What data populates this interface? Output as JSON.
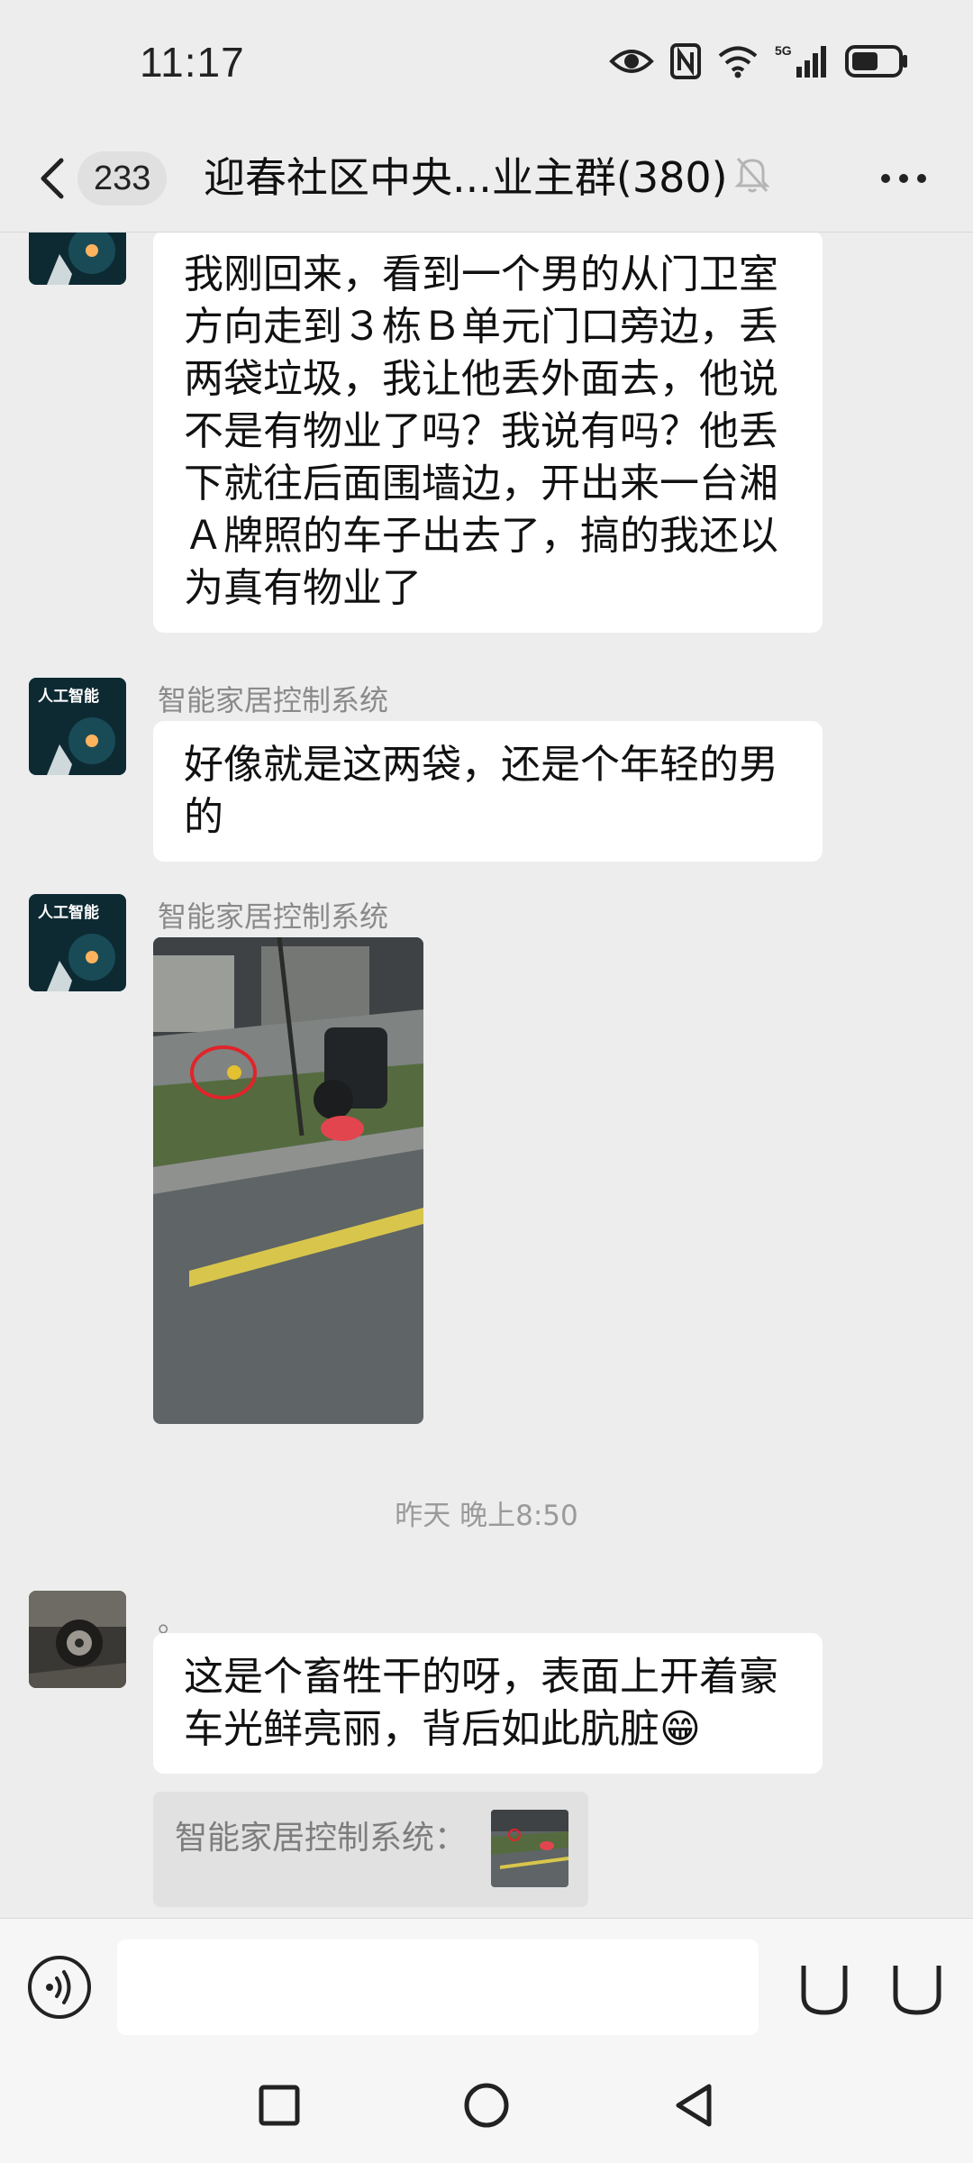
{
  "status_bar": {
    "time": "11:17",
    "network": "5G"
  },
  "header": {
    "unread_count": "233",
    "title": "迎春社区中央...业主群(380)"
  },
  "messages": [
    {
      "type": "text",
      "text": "我刚回来，看到一个男的从门卫室方向走到３栋Ｂ单元门口旁边，丢两袋垃圾，我让他丢外面去，他说不是有物业了吗？我说有吗？他丢下就往后面围墙边，开出来一台湘Ａ牌照的车子出去了，搞的我还以为真有物业了"
    },
    {
      "type": "text",
      "sender": "智能家居控制系统",
      "avatar_text": "人工智能",
      "text": "好像就是这两袋，还是个年轻的男的"
    },
    {
      "type": "image",
      "sender": "智能家居控制系统",
      "avatar_text": "人工智能"
    },
    {
      "type": "time",
      "text": "昨天 晚上8:50"
    },
    {
      "type": "text",
      "sender": "。",
      "text": "这是个畜牲干的呀，表面上开着豪车光鲜亮丽，背后如此肮脏😁"
    },
    {
      "type": "quote",
      "text": "智能家居控制系统："
    }
  ],
  "colors": {
    "background": "#ededed",
    "bubble": "#ffffff",
    "sender_name": "#8a8a8a",
    "quote_bg": "#e1e1e1"
  },
  "icons": [
    "back-arrow-icon",
    "mute-bell-icon",
    "more-icon",
    "voice-icon",
    "emoji-icon",
    "plus-icon",
    "eye-icon",
    "nfc-icon",
    "wifi-icon",
    "signal-icon",
    "battery-icon",
    "recent-apps-icon",
    "home-icon",
    "back-nav-icon"
  ]
}
